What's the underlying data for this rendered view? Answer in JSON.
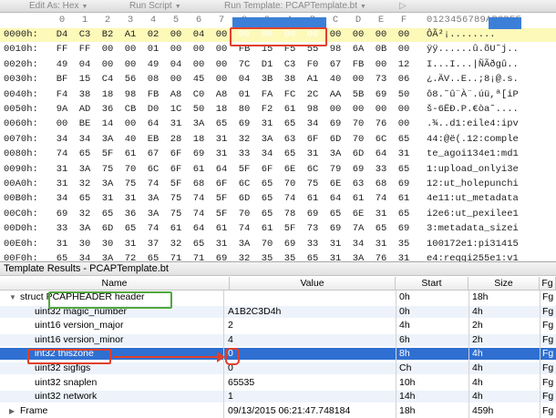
{
  "toolbar": {
    "edit_as": "Edit As: Hex",
    "run_script": "Run Script",
    "run_template": "Run Template: PCAPTemplate.bt"
  },
  "hex": {
    "col_headers": [
      "0",
      "1",
      "2",
      "3",
      "4",
      "5",
      "6",
      "7",
      "8",
      "9",
      "A",
      "B",
      "C",
      "D",
      "E",
      "F"
    ],
    "ascii_header": "0123456789ABCDEF",
    "rows": [
      {
        "offset": "0000h:",
        "bytes": [
          "D4",
          "C3",
          "B2",
          "A1",
          "02",
          "00",
          "04",
          "00",
          "00",
          "00",
          "00",
          "00",
          "00",
          "00",
          "00",
          "00"
        ],
        "ascii": "ÔÃ²¡........"
      },
      {
        "offset": "0010h:",
        "bytes": [
          "FF",
          "FF",
          "00",
          "00",
          "01",
          "00",
          "00",
          "00",
          "FB",
          "15",
          "F5",
          "55",
          "98",
          "6A",
          "0B",
          "00"
        ],
        "ascii": "ÿÿ......û.õU˜j.."
      },
      {
        "offset": "0020h:",
        "bytes": [
          "49",
          "04",
          "00",
          "00",
          "49",
          "04",
          "00",
          "00",
          "7C",
          "D1",
          "C3",
          "F0",
          "67",
          "FB",
          "00",
          "12"
        ],
        "ascii": "I...I...|ÑÃðgû.."
      },
      {
        "offset": "0030h:",
        "bytes": [
          "BF",
          "15",
          "C4",
          "56",
          "08",
          "00",
          "45",
          "00",
          "04",
          "3B",
          "38",
          "A1",
          "40",
          "00",
          "73",
          "06"
        ],
        "ascii": "¿.ÄV..E..;8¡@.s."
      },
      {
        "offset": "0040h:",
        "bytes": [
          "F4",
          "38",
          "18",
          "98",
          "FB",
          "A8",
          "C0",
          "A8",
          "01",
          "FA",
          "FC",
          "2C",
          "AA",
          "5B",
          "69",
          "50"
        ],
        "ascii": "ô8.˜û¨À¨.úü,ª[iP"
      },
      {
        "offset": "0050h:",
        "bytes": [
          "9A",
          "AD",
          "36",
          "CB",
          "D0",
          "1C",
          "50",
          "18",
          "80",
          "F2",
          "61",
          "98",
          "00",
          "00",
          "00",
          "00"
        ],
        "ascii": "š-6ËÐ.P.€òa˜...."
      },
      {
        "offset": "0060h:",
        "bytes": [
          "00",
          "BE",
          "14",
          "00",
          "64",
          "31",
          "3A",
          "65",
          "69",
          "31",
          "65",
          "34",
          "69",
          "70",
          "76",
          "00"
        ],
        "ascii": ".¾..d1:eile4:ipv"
      },
      {
        "offset": "0070h:",
        "bytes": [
          "34",
          "34",
          "3A",
          "40",
          "EB",
          "28",
          "18",
          "31",
          "32",
          "3A",
          "63",
          "6F",
          "6D",
          "70",
          "6C",
          "65"
        ],
        "ascii": "44:@ë(.12:comple"
      },
      {
        "offset": "0080h:",
        "bytes": [
          "74",
          "65",
          "5F",
          "61",
          "67",
          "6F",
          "69",
          "31",
          "33",
          "34",
          "65",
          "31",
          "3A",
          "6D",
          "64",
          "31"
        ],
        "ascii": "te_agoi134e1:md1"
      },
      {
        "offset": "0090h:",
        "bytes": [
          "31",
          "3A",
          "75",
          "70",
          "6C",
          "6F",
          "61",
          "64",
          "5F",
          "6F",
          "6E",
          "6C",
          "79",
          "69",
          "33",
          "65"
        ],
        "ascii": "1:upload_onlyi3e"
      },
      {
        "offset": "00A0h:",
        "bytes": [
          "31",
          "32",
          "3A",
          "75",
          "74",
          "5F",
          "68",
          "6F",
          "6C",
          "65",
          "70",
          "75",
          "6E",
          "63",
          "68",
          "69"
        ],
        "ascii": "12:ut_holepunchi"
      },
      {
        "offset": "00B0h:",
        "bytes": [
          "34",
          "65",
          "31",
          "31",
          "3A",
          "75",
          "74",
          "5F",
          "6D",
          "65",
          "74",
          "61",
          "64",
          "61",
          "74",
          "61"
        ],
        "ascii": "4e11:ut_metadata"
      },
      {
        "offset": "00C0h:",
        "bytes": [
          "69",
          "32",
          "65",
          "36",
          "3A",
          "75",
          "74",
          "5F",
          "70",
          "65",
          "78",
          "69",
          "65",
          "6E",
          "31",
          "65"
        ],
        "ascii": "i2e6:ut_pexilee1"
      },
      {
        "offset": "00D0h:",
        "bytes": [
          "33",
          "3A",
          "6D",
          "65",
          "74",
          "61",
          "64",
          "61",
          "74",
          "61",
          "5F",
          "73",
          "69",
          "7A",
          "65",
          "69"
        ],
        "ascii": "3:metadata_sizei"
      },
      {
        "offset": "00E0h:",
        "bytes": [
          "31",
          "30",
          "30",
          "31",
          "37",
          "32",
          "65",
          "31",
          "3A",
          "70",
          "69",
          "33",
          "31",
          "34",
          "31",
          "35"
        ],
        "ascii": "100172e1:pi31415"
      },
      {
        "offset": "00F0h:",
        "bytes": [
          "65",
          "34",
          "3A",
          "72",
          "65",
          "71",
          "71",
          "69",
          "32",
          "35",
          "35",
          "65",
          "31",
          "3A",
          "76",
          "31"
        ],
        "ascii": "e4:reqqi255e1:v1"
      }
    ]
  },
  "results": {
    "title": "Template Results - PCAPTemplate.bt",
    "columns": {
      "name": "Name",
      "value": "Value",
      "start": "Start",
      "size": "Size",
      "extra": "Fg"
    },
    "rows": [
      {
        "name": "struct PCAPHEADER header",
        "value": "",
        "start": "0h",
        "size": "18h",
        "extra": "Fg"
      },
      {
        "name": "uint32 magic_number",
        "value": "A1B2C3D4h",
        "start": "0h",
        "size": "4h",
        "extra": "Fg"
      },
      {
        "name": "uint16 version_major",
        "value": "2",
        "start": "4h",
        "size": "2h",
        "extra": "Fg"
      },
      {
        "name": "uint16 version_minor",
        "value": "4",
        "start": "6h",
        "size": "2h",
        "extra": "Fg"
      },
      {
        "name": "int32 thiszone",
        "value": "0",
        "start": "8h",
        "size": "4h",
        "extra": "Fg"
      },
      {
        "name": "uint32 sigfigs",
        "value": "0",
        "start": "Ch",
        "size": "4h",
        "extra": "Fg"
      },
      {
        "name": "uint32 snaplen",
        "value": "65535",
        "start": "10h",
        "size": "4h",
        "extra": "Fg"
      },
      {
        "name": "uint32 network",
        "value": "1",
        "start": "14h",
        "size": "4h",
        "extra": "Fg"
      },
      {
        "name": "Frame",
        "value": "09/13/2015 06:21:47.748184",
        "start": "18h",
        "size": "459h",
        "extra": "Fg"
      }
    ]
  }
}
